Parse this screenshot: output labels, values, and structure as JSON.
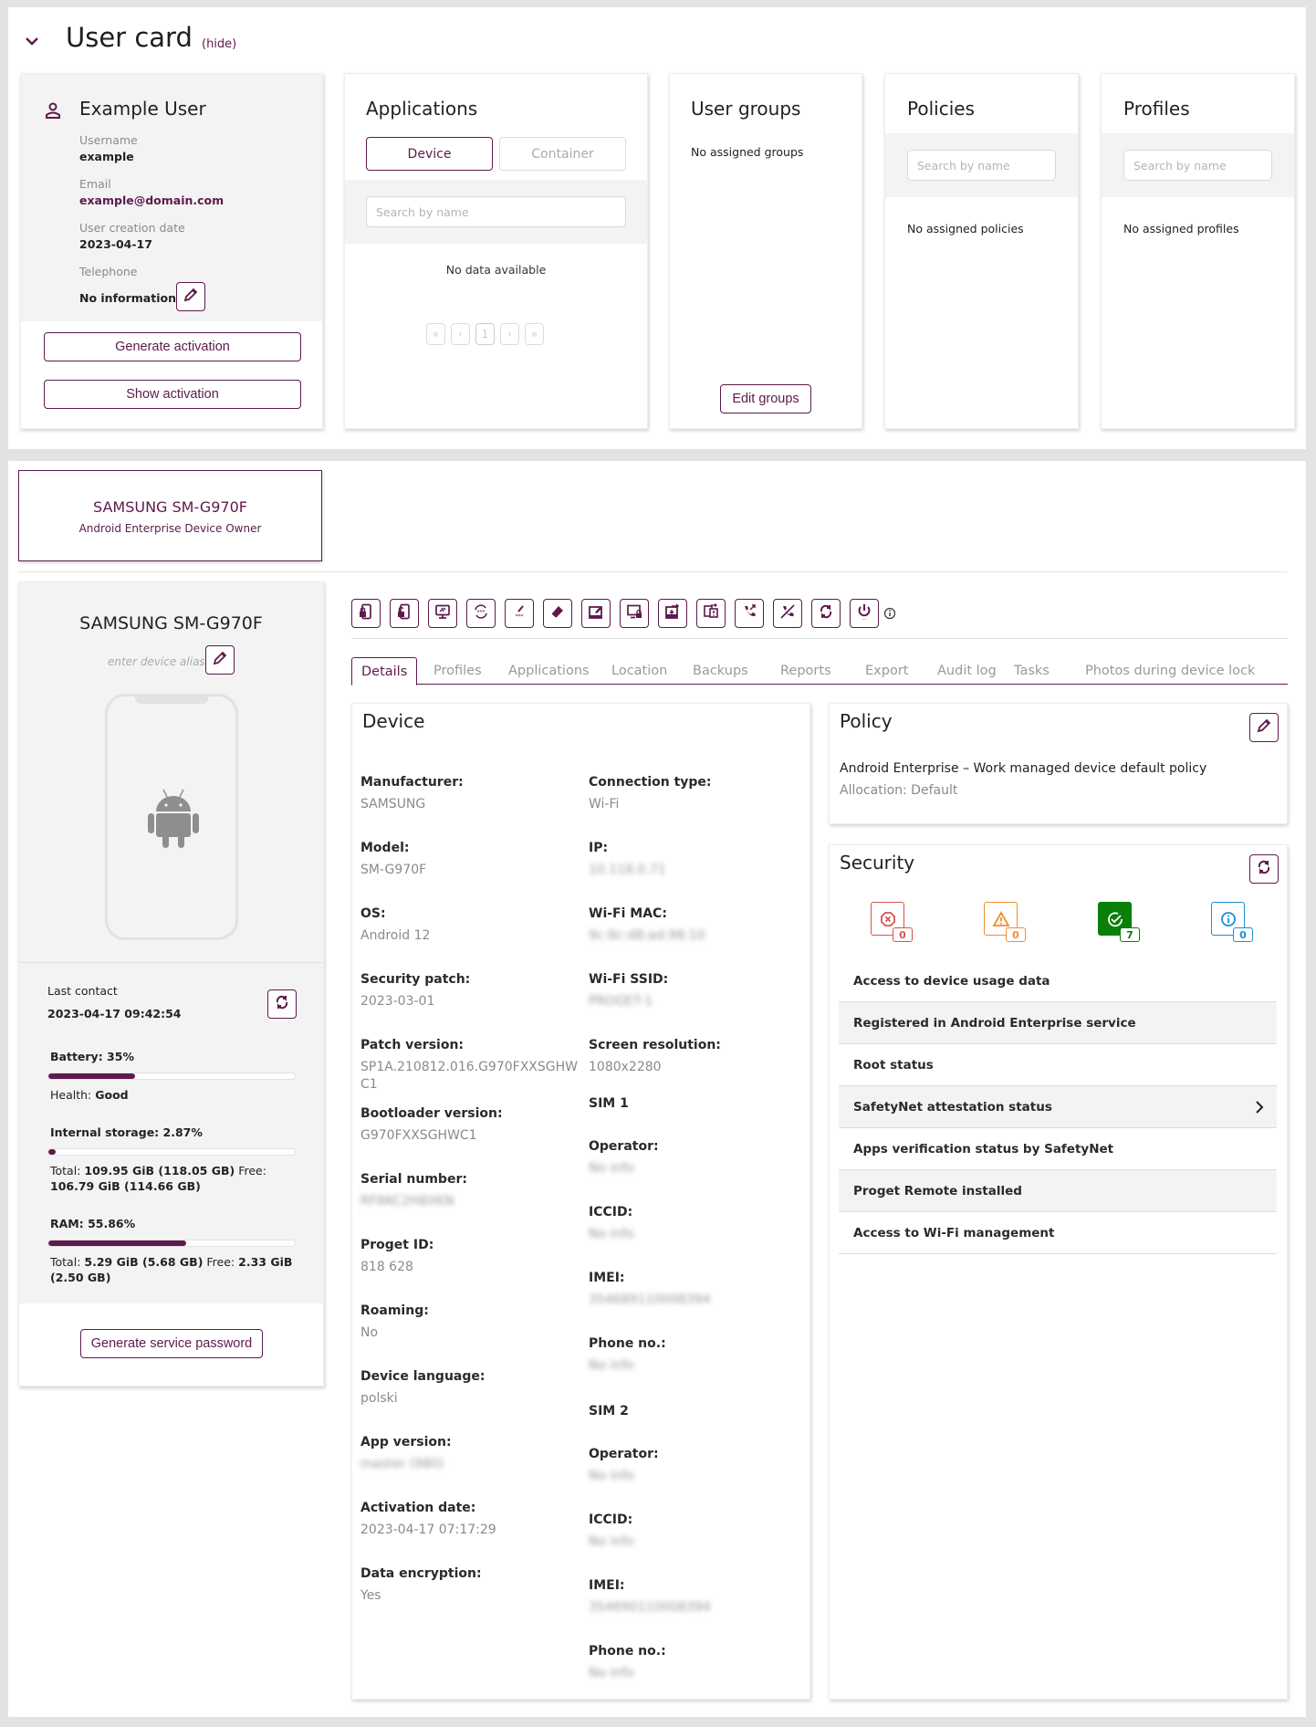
{
  "colors": {
    "accent": "#5e1a4c",
    "error": "#d9534f",
    "warning": "#ef8f2c",
    "success": "#0a7f0a",
    "info": "#1b8fd1",
    "page_background": "#e3e3e3"
  },
  "user_card": {
    "title": "User card",
    "hide_label": "(hide)",
    "user": {
      "name": "Example User",
      "username_label": "Username",
      "username": "example",
      "email_label": "Email",
      "email": "example@domain.com",
      "creation_label": "User creation date",
      "creation_date": "2023-04-17",
      "telephone_label": "Telephone",
      "telephone": "No information",
      "generate_activation": "Generate activation",
      "show_activation": "Show activation"
    },
    "applications": {
      "title": "Applications",
      "tab_device": "Device",
      "tab_container": "Container",
      "search_placeholder": "Search by name",
      "empty": "No data available",
      "pagination": [
        "«",
        "‹",
        "1",
        "›",
        "»"
      ]
    },
    "user_groups": {
      "title": "User groups",
      "empty": "No assigned groups",
      "edit_button": "Edit groups"
    },
    "policies": {
      "title": "Policies",
      "search_placeholder": "Search by name",
      "empty": "No assigned policies"
    },
    "profiles": {
      "title": "Profiles",
      "search_placeholder": "Search by name",
      "empty": "No assigned profiles"
    }
  },
  "device_tile": {
    "name": "SAMSUNG SM-G970F",
    "mode": "Android Enterprise Device Owner"
  },
  "device_sidebar": {
    "name": "SAMSUNG SM-G970F",
    "alias_placeholder": "enter device alias",
    "os_icon": "android-icon",
    "last_contact_label": "Last contact",
    "last_contact": "2023-04-17 09:42:54",
    "battery_label": "Battery: 35%",
    "battery_percent": 35,
    "health_label": "Health:",
    "health": "Good",
    "storage_label": "Internal storage: 2.87%",
    "storage_percent": 2.87,
    "storage_total_label": "Total:",
    "storage_total": "109.95 GiB (118.05 GB)",
    "storage_free_label": "Free:",
    "storage_free": "106.79 GiB (114.66 GB)",
    "ram_label": "RAM: 55.86%",
    "ram_percent": 55.86,
    "ram_total_label": "Total:",
    "ram_total": "5.29 GiB (5.68 GB)",
    "ram_free_label": "Free:",
    "ram_free": "2.33 GiB (2.50 GB)",
    "service_password_button": "Generate service password"
  },
  "actions": [
    "lock-device-icon",
    "unlock-device-icon",
    "remote-screen-icon",
    "reset-password-icon",
    "set-password-icon",
    "wipe-icon",
    "send-message-icon",
    "lock-screen-icon",
    "transfer-file-icon",
    "push-notification-icon",
    "call-icon",
    "block-calls-icon",
    "sync-icon",
    "power-icon"
  ],
  "tabs": [
    "Details",
    "Profiles",
    "Applications",
    "Location",
    "Backups",
    "Reports",
    "Export",
    "Audit log",
    "Tasks",
    "Photos during device lock"
  ],
  "active_tab": "Details",
  "device_details": {
    "title": "Device",
    "left": [
      {
        "label": "Manufacturer:",
        "value": "SAMSUNG"
      },
      {
        "label": "Model:",
        "value": "SM-G970F"
      },
      {
        "label": "OS:",
        "value": "Android 12"
      },
      {
        "label": "Security patch:",
        "value": "2023-03-01"
      },
      {
        "label": "Patch version:",
        "value": "SP1A.210812.016.G970FXXSGHWC1"
      },
      {
        "label": "Bootloader version:",
        "value": "G970FXXSGHWC1"
      },
      {
        "label": "Serial number:",
        "value": "RF8KC2H8XKN",
        "blurred": true
      },
      {
        "label": "Proget ID:",
        "value": "818 628"
      },
      {
        "label": "Roaming:",
        "value": "No"
      },
      {
        "label": "Device language:",
        "value": "polski"
      },
      {
        "label": "App version:",
        "value": "master (980)",
        "blurred": true
      },
      {
        "label": "Activation date:",
        "value": "2023-04-17 07:17:29"
      },
      {
        "label": "Data encryption:",
        "value": "Yes"
      }
    ],
    "right": [
      {
        "label": "Connection type:",
        "value": "Wi-Fi"
      },
      {
        "label": "IP:",
        "value": "10.118.0.71",
        "blurred": true
      },
      {
        "label": "Wi-Fi MAC:",
        "value": "9c:8c:d8:ad:98:10",
        "blurred": true
      },
      {
        "label": "Wi-Fi SSID:",
        "value": "PROGET-1",
        "blurred": true
      },
      {
        "label": "Screen resolution:",
        "value": "1080x2280"
      }
    ],
    "sim1": {
      "title": "SIM 1",
      "fields": [
        {
          "label": "Operator:",
          "value": "No info",
          "blurred": true
        },
        {
          "label": "ICCID:",
          "value": "No info",
          "blurred": true
        },
        {
          "label": "IMEI:",
          "value": "354689110008394",
          "blurred": true
        },
        {
          "label": "Phone no.:",
          "value": "No info",
          "blurred": true
        }
      ]
    },
    "sim2": {
      "title": "SIM 2",
      "fields": [
        {
          "label": "Operator:",
          "value": "No info",
          "blurred": true
        },
        {
          "label": "ICCID:",
          "value": "No info",
          "blurred": true
        },
        {
          "label": "IMEI:",
          "value": "354690110008394",
          "blurred": true
        },
        {
          "label": "Phone no.:",
          "value": "No info",
          "blurred": true
        }
      ]
    }
  },
  "policy": {
    "title": "Policy",
    "name": "Android Enterprise – Work managed device default policy",
    "allocation": "Allocation: Default"
  },
  "security": {
    "title": "Security",
    "counters": [
      {
        "type": "error",
        "count": "0"
      },
      {
        "type": "warning",
        "count": "0"
      },
      {
        "type": "success",
        "count": "7"
      },
      {
        "type": "info",
        "count": "0"
      }
    ],
    "items": [
      "Access to device usage data",
      "Registered in Android Enterprise service",
      "Root status",
      "SafetyNet attestation status",
      "Apps verification status by SafetyNet",
      "Proget Remote installed",
      "Access to Wi-Fi management"
    ]
  }
}
